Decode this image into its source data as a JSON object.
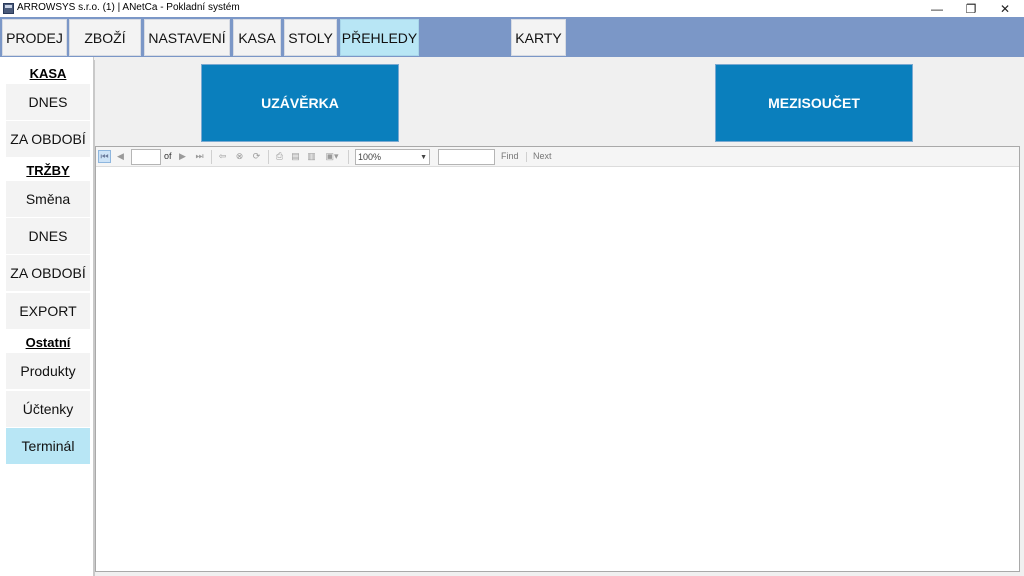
{
  "window": {
    "title": "ARROWSYS s.r.o. (1) | ANetCa - Pokladní systém",
    "minimize_glyph": "—",
    "restore_glyph": "❐",
    "close_glyph": "✕"
  },
  "nav": {
    "tabs": [
      {
        "label": "PRODEJ"
      },
      {
        "label": "ZBOŽÍ"
      },
      {
        "label": "NASTAVENÍ"
      },
      {
        "label": "KASA"
      },
      {
        "label": "STOLY"
      },
      {
        "label": "PŘEHLEDY",
        "active": true
      },
      {
        "label": "KARTY"
      }
    ]
  },
  "sidebar": {
    "kasa": {
      "heading": "KASA",
      "items": [
        {
          "label": "DNES"
        },
        {
          "label": "ZA OBDOBÍ"
        }
      ]
    },
    "trzby": {
      "heading": "TRŽBY",
      "items": [
        {
          "label": "Směna"
        },
        {
          "label": "DNES"
        },
        {
          "label": "ZA OBDOBÍ"
        },
        {
          "label": "EXPORT"
        }
      ]
    },
    "ostatni": {
      "heading": "Ostatní",
      "items": [
        {
          "label": "Produkty"
        },
        {
          "label": "Účtenky"
        },
        {
          "label": "Terminál",
          "active": true
        }
      ]
    }
  },
  "actions": {
    "uzaverka": "UZÁVĚRKA",
    "mezisoucet": "MEZISOUČET"
  },
  "report_toolbar": {
    "page_value": "",
    "of_label": "of",
    "zoom_value": "100%",
    "find_value": "",
    "find_label": "Find",
    "next_label": "Next"
  },
  "colors": {
    "nav_background": "#7b97c7",
    "active_tab": "#b8e6f5",
    "action_button": "#0a7fbd"
  }
}
